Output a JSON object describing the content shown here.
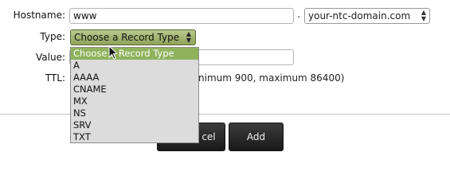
{
  "form": {
    "hostname_label": "Hostname:",
    "hostname_value": "www",
    "dot": ".",
    "domain_value": "your-ntc-domain.com",
    "type_label": "Type:",
    "type_selected": "Choose a Record Type",
    "value_label": "Value:",
    "value_value": "",
    "ttl_label": "TTL:",
    "ttl_hint": "nimum 900, maximum 86400)"
  },
  "dropdown": {
    "options": [
      "Choose a Record Type",
      "A",
      "AAAA",
      "CNAME",
      "MX",
      "NS",
      "SRV",
      "TXT"
    ],
    "highlighted": "Choose a Record Type"
  },
  "buttons": {
    "cancel_label": "cel",
    "add_label": "Add"
  },
  "colors": {
    "selected_option_bg": "#8fb25b",
    "type_select_bg": "#a5b874",
    "button_bg": "#2b2b2b"
  }
}
